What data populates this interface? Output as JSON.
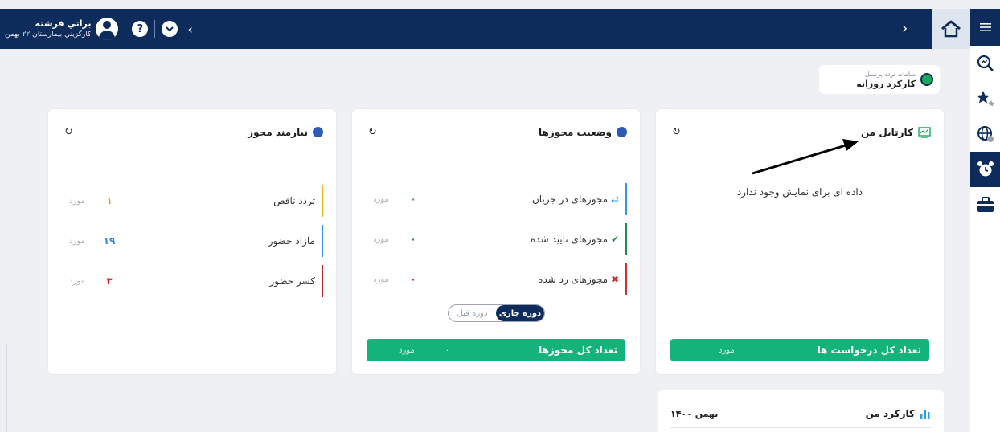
{
  "topbar": {
    "user_name": "براتي فرشته",
    "user_sub": "كارگزيني بيمارستان ۲۲ بهمن",
    "help_label": "?"
  },
  "sys": {
    "small": "سامانه تردد پرسنل",
    "title": "کارکرد روزانه"
  },
  "cards": {
    "kartabl": {
      "title": "کارتابل من",
      "empty": "داده ای برای نمایش وجود ندارد",
      "footer_label": "تعداد کل درخواست ها",
      "footer_unit": "مورد"
    },
    "permits": {
      "title": "وضعیت مجوزها",
      "rows": [
        {
          "label": "مجوزهای در جریان",
          "count": "۰",
          "unit": "مورد",
          "color": "#2f9be8"
        },
        {
          "label": "مجوزهای تایید شده",
          "count": "۰",
          "unit": "مورد",
          "color": "#1e8a4c"
        },
        {
          "label": "مجوزهای رد شده",
          "count": "۰",
          "unit": "مورد",
          "color": "#d32f2f"
        }
      ],
      "toggle_current": "دوره جاری",
      "toggle_prev": "دوره قبل",
      "footer_label": "تعداد کل مجوزها",
      "footer_count": "۰",
      "footer_unit": "مورد"
    },
    "needs": {
      "title": "نیازمند مجوز",
      "rows": [
        {
          "label": "تردد ناقص",
          "count": "۱",
          "unit": "مورد",
          "color": "#f2b01e"
        },
        {
          "label": "مازاد حضور",
          "count": "۱۹",
          "unit": "مورد",
          "color": "#2f9be8"
        },
        {
          "label": "کسر حضور",
          "count": "۳",
          "unit": "مورد",
          "color": "#c62828"
        }
      ]
    },
    "karkard": {
      "title": "کارکرد من",
      "date": "بهمن ۱۴۰۰"
    }
  }
}
